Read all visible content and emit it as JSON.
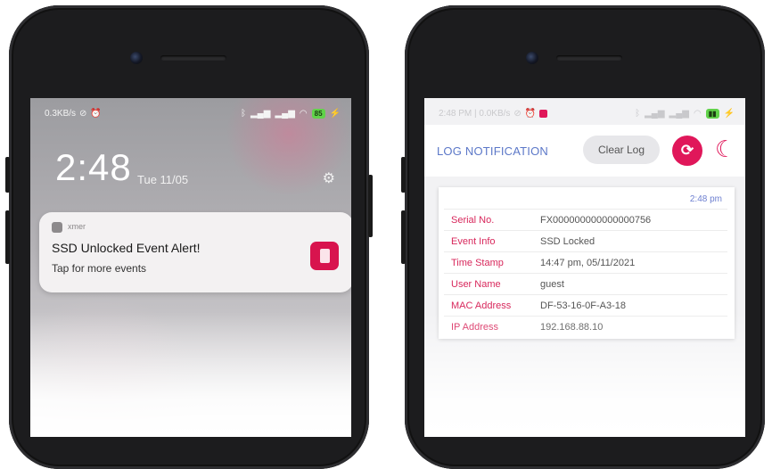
{
  "left_phone": {
    "status": {
      "speed": "0.3KB/s",
      "battery": "85"
    },
    "lock": {
      "time": "2:48",
      "date": "Tue 11/05"
    },
    "notification": {
      "app": "xmer",
      "title": "SSD Unlocked Event Alert!",
      "subtitle": "Tap for more events"
    }
  },
  "right_phone": {
    "status": {
      "left": "2:48 PM | 0.0KB/s"
    },
    "header": {
      "title": "LOG NOTIFICATION",
      "clear_label": "Clear Log"
    },
    "log": {
      "time": "2:48 pm",
      "rows": [
        {
          "label": "Serial No.",
          "value": "FX000000000000000756"
        },
        {
          "label": "Event Info",
          "value": "SSD Locked"
        },
        {
          "label": "Time Stamp",
          "value": "14:47 pm, 05/11/2021"
        },
        {
          "label": "User Name",
          "value": "guest"
        },
        {
          "label": "MAC Address",
          "value": "DF-53-16-0F-A3-18"
        },
        {
          "label": "IP Address",
          "value": "192.168.88.10"
        }
      ]
    }
  },
  "colors": {
    "accent": "#e0175a",
    "title_blue": "#5c78c8",
    "label_pink": "#d8285c"
  }
}
